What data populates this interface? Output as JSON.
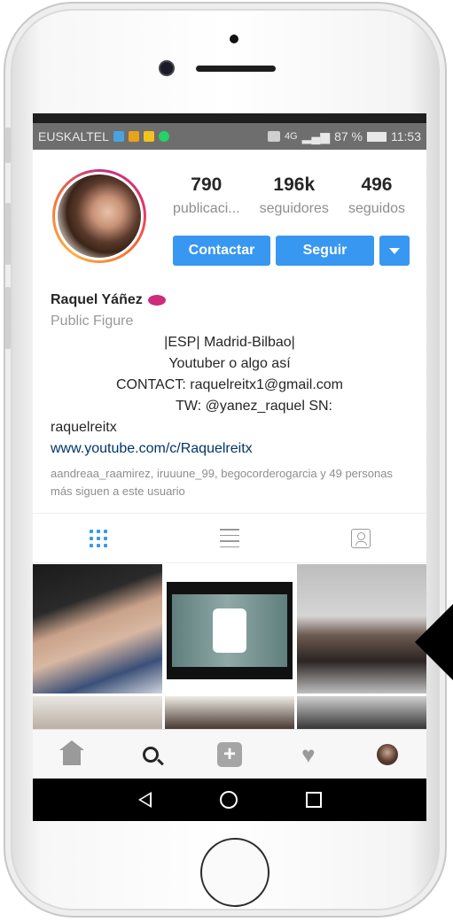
{
  "status_bar": {
    "carrier": "EUSKALTEL",
    "right_text": "87 %",
    "time": "11:53",
    "network": "4G"
  },
  "profile": {
    "stats": [
      {
        "number": "790",
        "label": "publicaci..."
      },
      {
        "number": "196k",
        "label": "seguidores"
      },
      {
        "number": "496",
        "label": "seguidos"
      }
    ],
    "contact_label": "Contactar",
    "follow_label": "Seguir",
    "name": "Raquel Yáñez",
    "category": "Public Figure",
    "bio_lines": [
      "|ESP| Madrid-Bilbao|",
      "Youtuber o algo así",
      "CONTACT: raquelreitx1@gmail.com",
      "TW: @yanez_raquel SN:",
      "raquelreitx"
    ],
    "website": "www.youtube.com/c/Raquelreitx",
    "followed_by": "aandreaa_raamirez, iruuune_99, begocorderogarcia y 49 personas más siguen a este usuario"
  },
  "colors": {
    "accent": "#3897f0",
    "link": "#003569",
    "muted": "#8e8e8e"
  },
  "icons": {
    "view_tabs": [
      "grid-icon",
      "list-icon",
      "tagged-icon"
    ],
    "bottom_nav": [
      "home-icon",
      "search-icon",
      "add-icon",
      "heart-icon",
      "profile-icon"
    ],
    "android_nav": [
      "back-icon",
      "home-circle-icon",
      "recents-icon"
    ]
  }
}
